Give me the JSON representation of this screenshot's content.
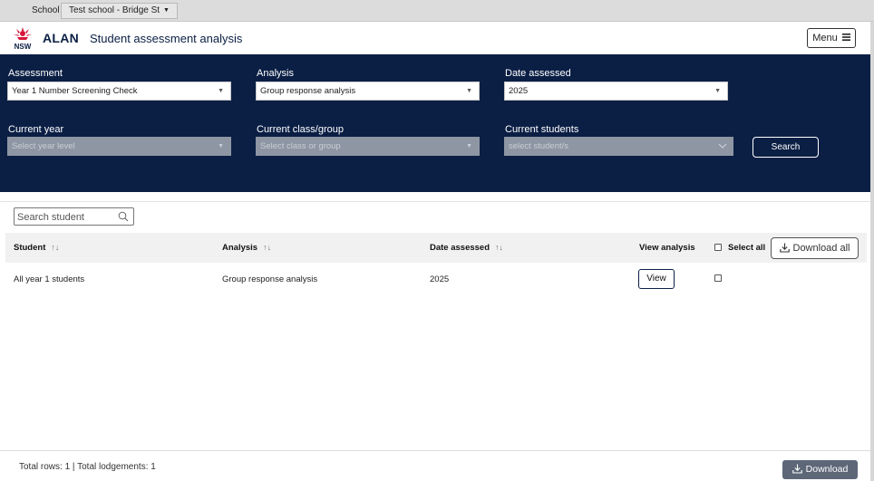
{
  "school_bar": {
    "label": "School",
    "selected_school": "Test school - Bridge St"
  },
  "header": {
    "logo_text": "NSW",
    "app_name": "ALAN",
    "page_title": "Student assessment analysis",
    "menu_label": "Menu"
  },
  "filters": {
    "assessment": {
      "label": "Assessment",
      "value": "Year 1 Number Screening Check"
    },
    "analysis": {
      "label": "Analysis",
      "value": "Group response analysis"
    },
    "date_assessed": {
      "label": "Date assessed",
      "value": "2025"
    },
    "current_year": {
      "label": "Current year",
      "placeholder": "Select year level"
    },
    "current_class": {
      "label": "Current class/group",
      "placeholder": "Select class or group"
    },
    "current_students": {
      "label": "Current students",
      "placeholder": "select student/s"
    },
    "search_label": "Search"
  },
  "student_search": {
    "placeholder": "Search student"
  },
  "table": {
    "headers": {
      "student": "Student",
      "analysis": "Analysis",
      "date_assessed": "Date assessed",
      "view_analysis": "View analysis",
      "select_all": "Select all"
    },
    "download_all_label": "Download all",
    "rows": [
      {
        "student": "All year 1 students",
        "analysis": "Group response analysis",
        "date_assessed": "2025",
        "view_label": "View"
      }
    ]
  },
  "footer": {
    "totals": "Total rows: 1 | Total lodgements: 1",
    "download_label": "Download"
  },
  "colors": {
    "panel_bg": "#0b1f45",
    "brand_red": "#d7153a",
    "download_btn": "#5d6778"
  },
  "icons": [
    "chevron-down-icon",
    "nsw-waratah-logo",
    "hamburger-icon",
    "search-icon",
    "sort-icon",
    "download-icon"
  ]
}
